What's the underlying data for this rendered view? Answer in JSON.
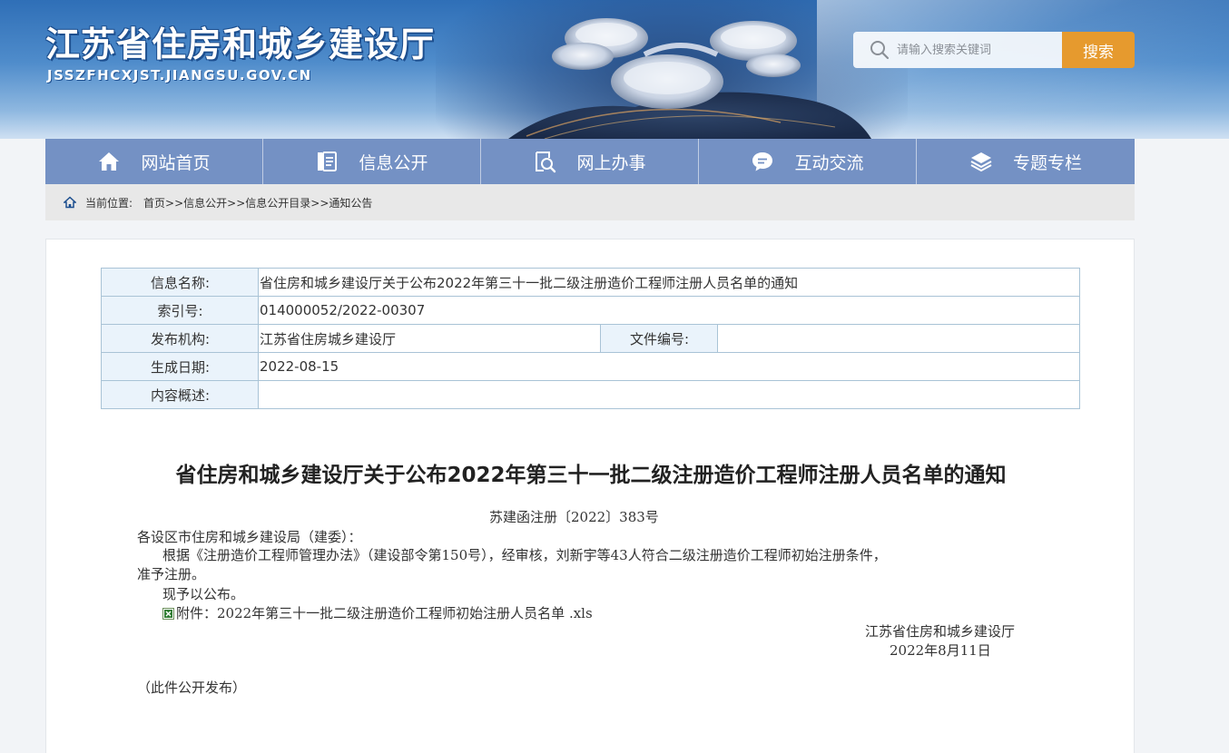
{
  "header": {
    "site_title": "江苏省住房和城乡建设厅",
    "site_domain": "JSSZFHCXJST.JIANGSU.GOV.CN",
    "search": {
      "placeholder": "请输入搜索关键词",
      "button_label": "搜索"
    }
  },
  "nav": {
    "items": [
      {
        "label": "网站首页",
        "icon": "home-icon"
      },
      {
        "label": "信息公开",
        "icon": "document-icon"
      },
      {
        "label": "网上办事",
        "icon": "search-doc-icon"
      },
      {
        "label": "互动交流",
        "icon": "chat-icon"
      },
      {
        "label": "专题专栏",
        "icon": "layers-icon"
      }
    ]
  },
  "breadcrumb": {
    "label": "当前位置:",
    "path": "首页>>信息公开>>信息公开目录>>通知公告"
  },
  "meta": {
    "name_label": "信息名称:",
    "name_value": "省住房和城乡建设厅关于公布2022年第三十一批二级注册造价工程师注册人员名单的通知",
    "index_label": "索引号:",
    "index_value": "014000052/2022-00307",
    "org_label": "发布机构:",
    "org_value": "江苏省住房城乡建设厅",
    "docno_label": "文件编号:",
    "docno_value": "",
    "date_label": "生成日期:",
    "date_value": "2022-08-15",
    "summary_label": "内容概述:",
    "summary_value": ""
  },
  "document": {
    "title": "省住房和城乡建设厅关于公布2022年第三十一批二级注册造价工程师注册人员名单的通知",
    "doc_number": "苏建函注册〔2022〕383号",
    "salutation": "各设区市住房和城乡建设局（建委）：",
    "body_line1": "根据《注册造价工程师管理办法》（建设部令第150号），经审核，刘新宇等43人符合二级注册造价工程师初始注册条件，",
    "body_line2": "准予注册。",
    "announce": "现予以公布。",
    "attachment": "附件：2022年第三十一批二级注册造价工程师初始注册人员名单 .xls",
    "signer": "江苏省住房和城乡建设厅",
    "sign_date": "2022年8月11日",
    "publish_note": "（此件公开发布）"
  },
  "colors": {
    "nav_bg": "#7491c4",
    "search_button": "#e69a2e",
    "breadcrumb_bg": "#e8e8e8",
    "table_border": "#a9c3d6",
    "table_label_bg": "#eaf3fb"
  }
}
